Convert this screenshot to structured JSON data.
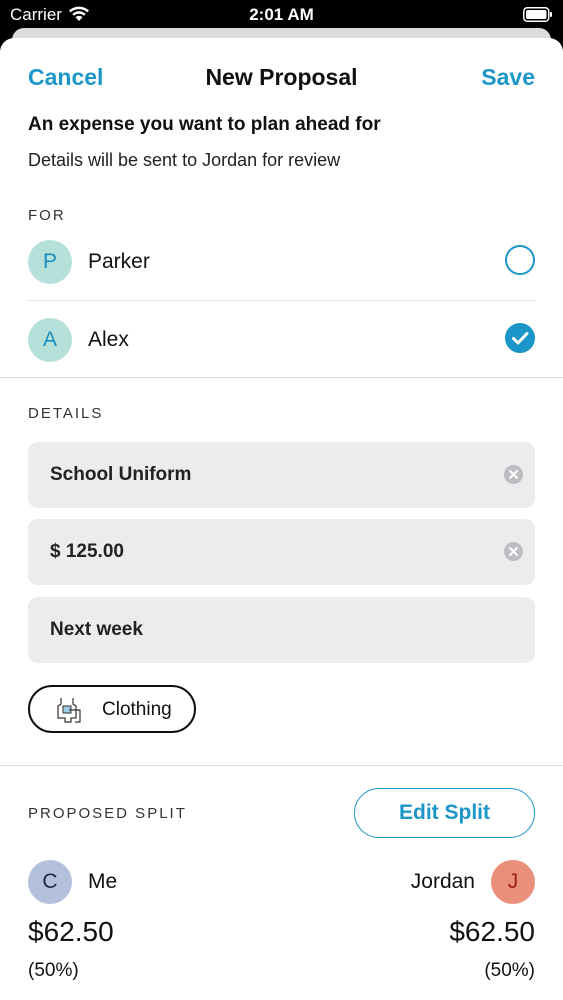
{
  "status_bar": {
    "carrier": "Carrier",
    "time": "2:01 AM"
  },
  "nav": {
    "cancel_label": "Cancel",
    "title": "New Proposal",
    "save_label": "Save"
  },
  "subtitle": "An expense you want to plan ahead for",
  "subtext": "Details will be sent to Jordan for review",
  "for_section": {
    "label": "FOR",
    "people": [
      {
        "initial": "P",
        "name": "Parker",
        "selected": false
      },
      {
        "initial": "A",
        "name": "Alex",
        "selected": true
      }
    ]
  },
  "details_section": {
    "label": "DETAILS",
    "name_value": "School Uniform",
    "amount_value": "$ 125.00",
    "date_value": "Next week",
    "category": "Clothing"
  },
  "split_section": {
    "label": "PROPOSED SPLIT",
    "edit_label": "Edit Split",
    "left": {
      "initial": "C",
      "name": "Me",
      "amount": "$62.50",
      "percent": "(50%)"
    },
    "right": {
      "initial": "J",
      "name": "Jordan",
      "amount": "$62.50",
      "percent": "(50%)"
    }
  },
  "colors": {
    "accent": "#1c96c8",
    "avatar_teal": "#b6e1da",
    "avatar_me": "#b3c1dd",
    "avatar_jordan": "#ea8f7a",
    "field_bg": "#ececee"
  }
}
